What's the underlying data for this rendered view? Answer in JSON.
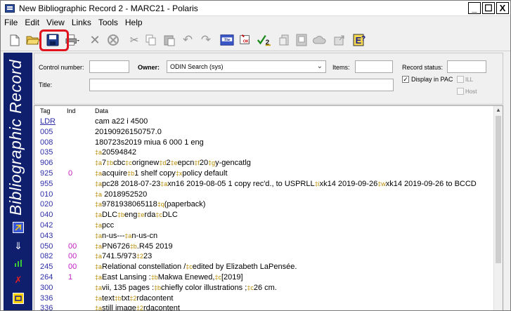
{
  "window": {
    "title": "New Bibliographic Record 2 - MARC21 -  Polaris",
    "min": "_",
    "max": "☐",
    "close": "X"
  },
  "menu": [
    "File",
    "Edit",
    "View",
    "Links",
    "Tools",
    "Help"
  ],
  "banner": {
    "text": "Bibliographic Record"
  },
  "header": {
    "control_number_label": "Control number:",
    "control_number_value": "",
    "owner_label": "Owner:",
    "owner_value": "ODIN Search (sys)",
    "items_label": "Items:",
    "items_value": "",
    "record_status_label": "Record status:",
    "record_status_value": "",
    "title_label": "Title:",
    "title_value": "",
    "display_in_pac_label": "Display in PAC",
    "display_in_pac_checked": "✓",
    "ill_label": "ILL",
    "host_label": "Host"
  },
  "grid": {
    "headers": {
      "tag": "Tag",
      "ind": "Ind",
      "data": "Data"
    },
    "rows": [
      {
        "tag": "LDR",
        "ind": "",
        "segments": [
          [
            "t",
            "         cam a22     i 4500"
          ]
        ]
      },
      {
        "tag": "005",
        "ind": "",
        "segments": [
          [
            "t",
            "20190926150757.0"
          ]
        ]
      },
      {
        "tag": "008",
        "ind": "",
        "segments": [
          [
            "t",
            "180723s2019    miua     6    000 1 eng"
          ]
        ]
      },
      {
        "tag": "035",
        "ind": "",
        "segments": [
          [
            "s",
            "‡a"
          ],
          [
            "t",
            "20594842"
          ]
        ]
      },
      {
        "tag": "906",
        "ind": "",
        "segments": [
          [
            "s",
            "‡a"
          ],
          [
            "t",
            "7"
          ],
          [
            "s",
            "‡b"
          ],
          [
            "t",
            "cbc"
          ],
          [
            "s",
            "‡c"
          ],
          [
            "t",
            "orignew"
          ],
          [
            "s",
            "‡d"
          ],
          [
            "t",
            "2"
          ],
          [
            "s",
            "‡e"
          ],
          [
            "t",
            "epcn"
          ],
          [
            "s",
            "‡f"
          ],
          [
            "t",
            "20"
          ],
          [
            "s",
            "‡g"
          ],
          [
            "t",
            "y-gencatlg"
          ]
        ]
      },
      {
        "tag": "925",
        "ind": "0",
        "segments": [
          [
            "s",
            "‡a"
          ],
          [
            "t",
            "acquire"
          ],
          [
            "s",
            "‡b"
          ],
          [
            "t",
            "1 shelf copy"
          ],
          [
            "s",
            "‡x"
          ],
          [
            "t",
            "policy default"
          ]
        ]
      },
      {
        "tag": "955",
        "ind": "",
        "segments": [
          [
            "s",
            "‡a"
          ],
          [
            "t",
            "pc28 2018-07-23"
          ],
          [
            "s",
            "‡a"
          ],
          [
            "t",
            "xn16 2019-08-05 1 copy rec'd., to USPRLL"
          ],
          [
            "s",
            "‡i"
          ],
          [
            "t",
            "xk14 2019-09-26"
          ],
          [
            "s",
            "‡w"
          ],
          [
            "t",
            "xk14 2019-09-26 to BCCD"
          ]
        ]
      },
      {
        "tag": "010",
        "ind": "",
        "segments": [
          [
            "s",
            "‡a"
          ],
          [
            "t",
            "  2018952520"
          ]
        ]
      },
      {
        "tag": "020",
        "ind": "",
        "segments": [
          [
            "s",
            "‡a"
          ],
          [
            "t",
            "9781938065118"
          ],
          [
            "s",
            "‡q"
          ],
          [
            "t",
            "(paperback)"
          ]
        ]
      },
      {
        "tag": "040",
        "ind": "",
        "segments": [
          [
            "s",
            "‡a"
          ],
          [
            "t",
            "DLC"
          ],
          [
            "s",
            "‡b"
          ],
          [
            "t",
            "eng"
          ],
          [
            "s",
            "‡e"
          ],
          [
            "t",
            "rda"
          ],
          [
            "s",
            "‡c"
          ],
          [
            "t",
            "DLC"
          ]
        ]
      },
      {
        "tag": "042",
        "ind": "",
        "segments": [
          [
            "s",
            "‡a"
          ],
          [
            "t",
            "pcc"
          ]
        ]
      },
      {
        "tag": "043",
        "ind": "",
        "segments": [
          [
            "s",
            "‡a"
          ],
          [
            "t",
            "n-us---"
          ],
          [
            "s",
            "‡a"
          ],
          [
            "t",
            "n-us-cn"
          ]
        ]
      },
      {
        "tag": "050",
        "ind": "00",
        "segments": [
          [
            "s",
            "‡a"
          ],
          [
            "t",
            "PN6726"
          ],
          [
            "s",
            "‡b"
          ],
          [
            "t",
            ".R45 2019"
          ]
        ]
      },
      {
        "tag": "082",
        "ind": "00",
        "segments": [
          [
            "s",
            "‡a"
          ],
          [
            "t",
            "741.5/973"
          ],
          [
            "s",
            "‡2"
          ],
          [
            "t",
            "23"
          ]
        ]
      },
      {
        "tag": "245",
        "ind": "00",
        "segments": [
          [
            "s",
            "‡a"
          ],
          [
            "t",
            "Relational constellation /"
          ],
          [
            "s",
            "‡c"
          ],
          [
            "t",
            "edited by Elizabeth LaPensée."
          ]
        ]
      },
      {
        "tag": "264",
        "ind": " 1",
        "segments": [
          [
            "s",
            "‡a"
          ],
          [
            "t",
            "East Lansing :"
          ],
          [
            "s",
            "‡b"
          ],
          [
            "t",
            "Makwa Enewed,"
          ],
          [
            "s",
            "‡c"
          ],
          [
            "t",
            "[2019]"
          ]
        ]
      },
      {
        "tag": "300",
        "ind": "",
        "segments": [
          [
            "s",
            "‡a"
          ],
          [
            "t",
            "vii, 135 pages :"
          ],
          [
            "s",
            "‡b"
          ],
          [
            "t",
            "chiefly color illustrations ;"
          ],
          [
            "s",
            "‡c"
          ],
          [
            "t",
            "26 cm."
          ]
        ]
      },
      {
        "tag": "336",
        "ind": "",
        "segments": [
          [
            "s",
            "‡a"
          ],
          [
            "t",
            "text"
          ],
          [
            "s",
            "‡b"
          ],
          [
            "t",
            "txt"
          ],
          [
            "s",
            "‡2"
          ],
          [
            "t",
            "rdacontent"
          ]
        ]
      },
      {
        "tag": "336",
        "ind": "",
        "segments": [
          [
            "s",
            "‡a"
          ],
          [
            "t",
            "still image"
          ],
          [
            "s",
            "‡2"
          ],
          [
            "t",
            "rdacontent"
          ]
        ]
      }
    ]
  }
}
